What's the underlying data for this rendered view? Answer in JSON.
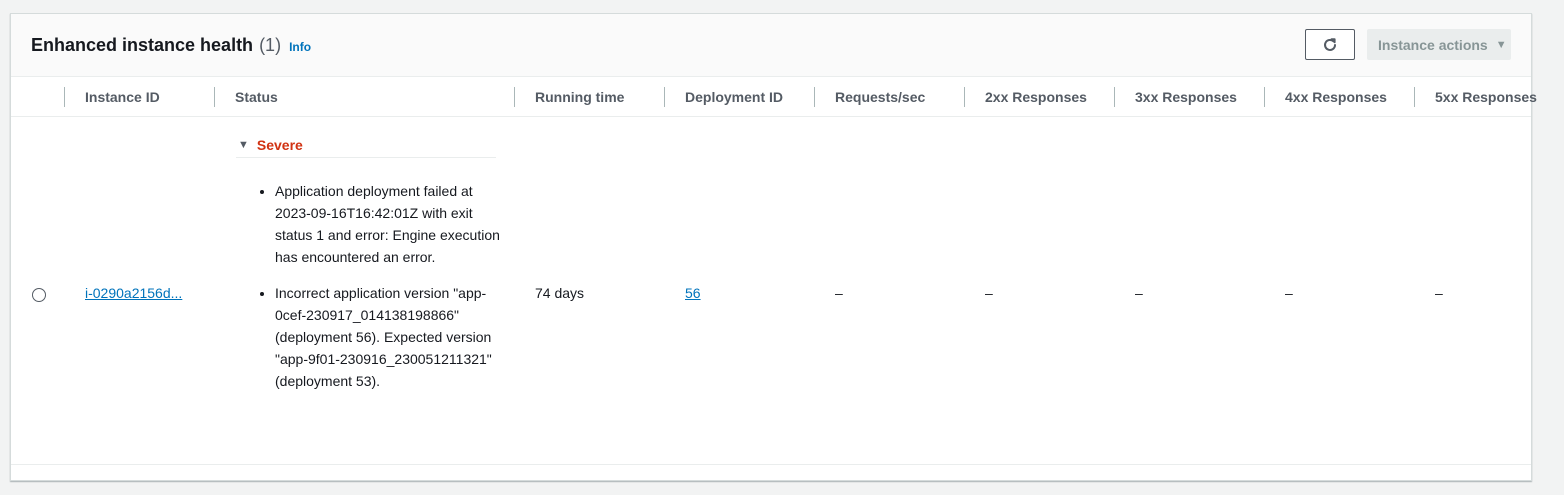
{
  "header": {
    "title": "Enhanced instance health",
    "count": "(1)",
    "info": "Info",
    "refresh_icon": "refresh-icon",
    "actions_label": "Instance actions",
    "actions_caret": "▼"
  },
  "columns": [
    "Instance ID",
    "Status",
    "Running time",
    "Deployment ID",
    "Requests/sec",
    "2xx Responses",
    "3xx Responses",
    "4xx Responses",
    "5xx Responses"
  ],
  "rows": [
    {
      "instance_id": "i-0290a2156d...",
      "status": "Severe",
      "causes": [
        "Application deployment failed at 2023-09-16T16:42:01Z with exit status 1 and error: Engine execution has encountered an error.",
        "Incorrect application version \"app-0cef-230917_014138198866\" (deployment 56). Expected version \"app-9f01-230916_230051211321\" (deployment 53)."
      ],
      "running_time": "74 days",
      "deployment_id": "56",
      "requests_sec": "–",
      "r2xx": "–",
      "r3xx": "–",
      "r4xx": "–",
      "r5xx": "–"
    }
  ],
  "colors": {
    "severe": "#d13212",
    "link": "#0073bb"
  }
}
